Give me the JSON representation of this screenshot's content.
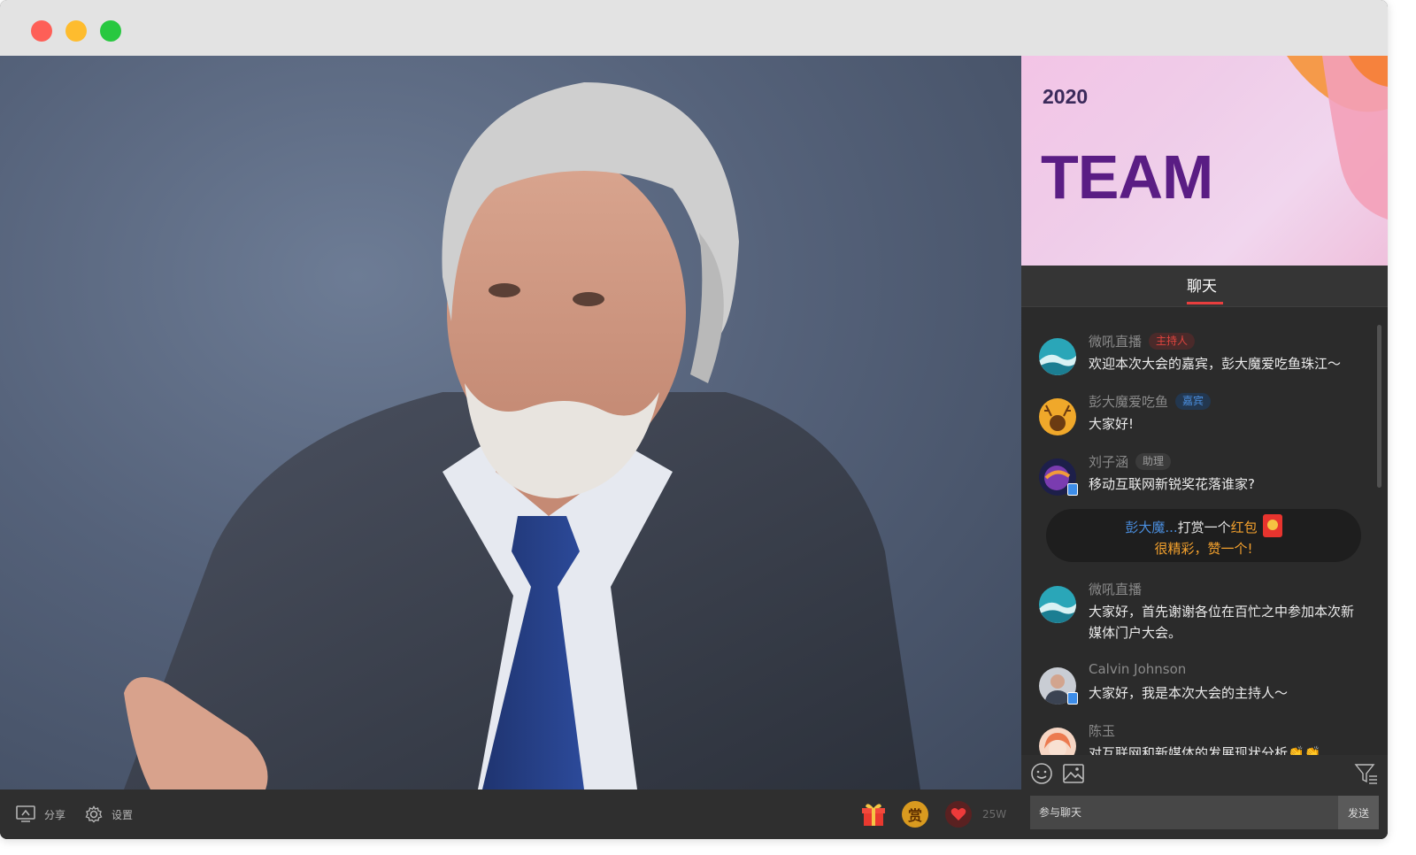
{
  "window": {
    "controls": [
      "close",
      "minimize",
      "maximize"
    ]
  },
  "toolbar": {
    "share_label": "分享",
    "settings_label": "设置",
    "like_count": "25W",
    "reward_icon_char": "赏"
  },
  "banner": {
    "year": "2020",
    "title": "TEAM"
  },
  "tabs": [
    {
      "label": "聊天",
      "active": true
    }
  ],
  "chat": {
    "messages": [
      {
        "name": "微吼直播",
        "badge": "主持人",
        "text": "欢迎本次大会的嘉宾，彭大魔爱吃鱼珠江～"
      },
      {
        "name": "彭大魔爱吃鱼",
        "badge": "嘉宾",
        "text": "大家好!"
      },
      {
        "name": "刘子涵",
        "badge": "助理",
        "text": "移动互联网新锐奖花落谁家?"
      },
      {
        "name": "微吼直播",
        "badge": "",
        "text": "大家好，首先谢谢各位在百忙之中参加本次新媒体门户大会。"
      },
      {
        "name": "Calvin Johnson",
        "badge": "",
        "text": "大家好，我是本次大会的主持人～"
      },
      {
        "name": "陈玉",
        "badge": "",
        "text": "对互联网和新媒体的发展现状分析👏👏"
      }
    ],
    "reward": {
      "user": "彭大魔...",
      "action": "打赏一个",
      "item": "红包",
      "comment": "很精彩，赞一个!"
    }
  },
  "input": {
    "placeholder": "参与聊天",
    "send_label": "发送"
  },
  "colors": {
    "accent": "#e83e3e",
    "guest_badge": "#4a8ede",
    "reward_orange": "#f4a12d"
  }
}
